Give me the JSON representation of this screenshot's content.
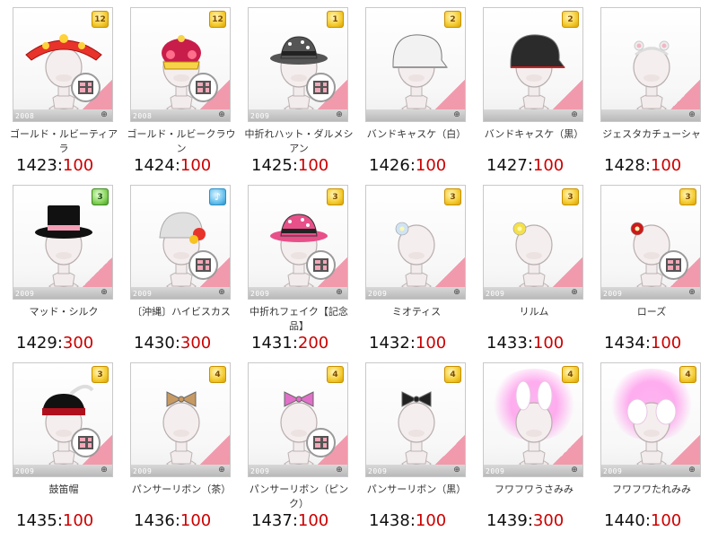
{
  "colors": {
    "price_value": "#cc0000",
    "price_id": "#111111",
    "badge_gold": "#f6cf3a",
    "card_border": "#c9c9c9"
  },
  "items": [
    {
      "name": "ゴールド・ルビーティアラ",
      "id": "1423",
      "price": "100",
      "badge": "12",
      "badge_style": "gold",
      "year": "2008",
      "item_icon": "tiara-icon",
      "hat": "#e8332a"
    },
    {
      "name": "ゴールド・ルビークラウン",
      "id": "1424",
      "price": "100",
      "badge": "12",
      "badge_style": "gold",
      "year": "2008",
      "item_icon": "crown-icon",
      "hat": "#c81d4a"
    },
    {
      "name": "中折れハット・ダルメシアン",
      "id": "1425",
      "price": "100",
      "badge": "1",
      "badge_style": "gold",
      "year": "2009",
      "item_icon": "fedora-hat-icon",
      "hat": "#555555"
    },
    {
      "name": "バンドキャスケ（白）",
      "id": "1426",
      "price": "100",
      "badge": "2",
      "badge_style": "gold",
      "year": "",
      "item_icon": "casquette-white-icon",
      "hat": "#f2f2f2"
    },
    {
      "name": "バンドキャスケ（黒）",
      "id": "1427",
      "price": "100",
      "badge": "2",
      "badge_style": "gold",
      "year": "",
      "item_icon": "casquette-black-icon",
      "hat": "#2b2b2b"
    },
    {
      "name": "ジェスタカチューシャ",
      "id": "1428",
      "price": "100",
      "badge": "",
      "badge_style": "none",
      "year": "",
      "item_icon": "headband-icon",
      "hat": "#f3b6c4"
    },
    {
      "name": "マッド・シルク",
      "id": "1429",
      "price": "300",
      "badge": "3",
      "badge_style": "green",
      "year": "2009",
      "item_icon": "top-hat-icon",
      "hat": "#111111"
    },
    {
      "name": "〔沖縄〕ハイビスカス",
      "id": "1430",
      "price": "300",
      "badge": "♪",
      "badge_style": "blue",
      "year": "2009",
      "item_icon": "hibiscus-hat-icon",
      "hat": "#e0e0e0"
    },
    {
      "name": "中折れフェイク【記念品】",
      "id": "1431",
      "price": "200",
      "badge": "3",
      "badge_style": "gold",
      "year": "2009",
      "item_icon": "pink-fedora-icon",
      "hat": "#e8508a"
    },
    {
      "name": "ミオティス",
      "id": "1432",
      "price": "100",
      "badge": "3",
      "badge_style": "gold",
      "year": "2009",
      "item_icon": "flower-clip-icon",
      "hat": "#cfe3f3"
    },
    {
      "name": "リルム",
      "id": "1433",
      "price": "100",
      "badge": "3",
      "badge_style": "gold",
      "year": "2009",
      "item_icon": "lily-clip-icon",
      "hat": "#f4e04a"
    },
    {
      "name": "ローズ",
      "id": "1434",
      "price": "100",
      "badge": "3",
      "badge_style": "gold",
      "year": "2009",
      "item_icon": "rose-clip-icon",
      "hat": "#cc1a1a"
    },
    {
      "name": "鼓笛帽",
      "id": "1435",
      "price": "100",
      "badge": "3",
      "badge_style": "gold",
      "year": "2009",
      "item_icon": "drum-hat-icon",
      "hat": "#b0101d"
    },
    {
      "name": "パンサーリボン（茶）",
      "id": "1436",
      "price": "100",
      "badge": "4",
      "badge_style": "gold",
      "year": "2009",
      "item_icon": "bow-brown-icon",
      "hat": "#c79a63"
    },
    {
      "name": "パンサーリボン（ピンク）",
      "id": "1437",
      "price": "100",
      "badge": "4",
      "badge_style": "gold",
      "year": "2009",
      "item_icon": "bow-pink-icon",
      "hat": "#e070c8"
    },
    {
      "name": "パンサーリボン（黒）",
      "id": "1438",
      "price": "100",
      "badge": "4",
      "badge_style": "gold",
      "year": "2009",
      "item_icon": "bow-black-icon",
      "hat": "#222222"
    },
    {
      "name": "フワフワうさみみ",
      "id": "1439",
      "price": "300",
      "badge": "4",
      "badge_style": "gold",
      "year": "2009",
      "item_icon": "bunny-ears-icon",
      "hat": "#ff7ee0"
    },
    {
      "name": "フワフワたれみみ",
      "id": "1440",
      "price": "100",
      "badge": "4",
      "badge_style": "gold",
      "year": "2009",
      "item_icon": "floppy-ears-icon",
      "hat": "#ff7ee0"
    }
  ]
}
